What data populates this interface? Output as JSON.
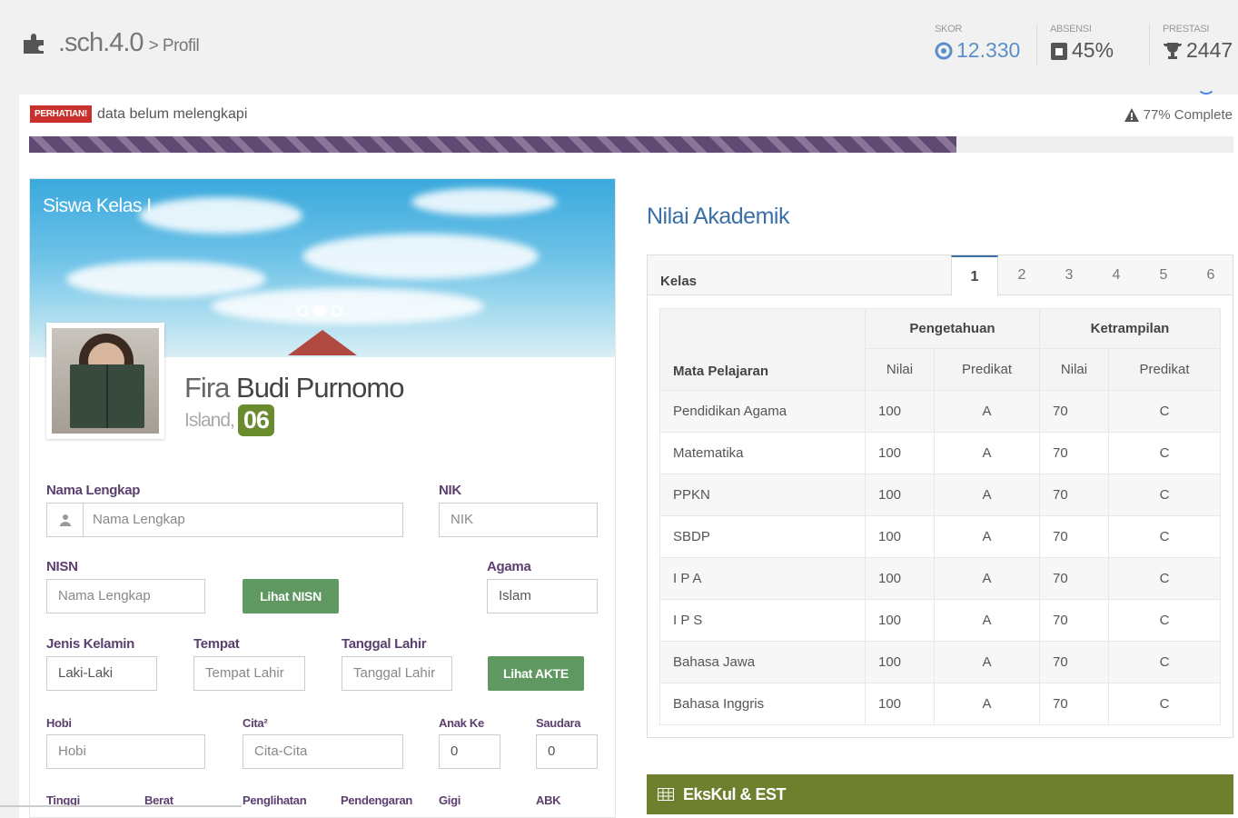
{
  "header": {
    "app_name": ".sch.4.0",
    "breadcrumb": "> Profil",
    "stats": [
      {
        "label": "SKOR",
        "value": "12.330",
        "icon": "coin-icon"
      },
      {
        "label": "ABSENSI",
        "value": "45%",
        "icon": "calendar-icon"
      },
      {
        "label": "PRESTASI",
        "value": "2447",
        "icon": "trophy-icon"
      }
    ]
  },
  "notice": {
    "badge": "PERHATIAN!",
    "message": "data belum melengkapi",
    "complete_text": "77% Complete",
    "progress_percent": 77
  },
  "profile": {
    "banner_title": "Siswa Kelas I",
    "first_name": "Fira",
    "last_name": "Budi Purnomo",
    "city": "Island,",
    "number": "06"
  },
  "form": {
    "nama_lengkap": {
      "label": "Nama Lengkap",
      "placeholder": "Nama Lengkap"
    },
    "nik": {
      "label": "NIK",
      "placeholder": "NIK"
    },
    "nisn": {
      "label": "NISN",
      "placeholder": "Nama Lengkap"
    },
    "lihat_nisn": "Lihat NISN",
    "agama": {
      "label": "Agama",
      "value": "Islam"
    },
    "jenis_kelamin": {
      "label": "Jenis Kelamin",
      "value": "Laki-Laki"
    },
    "tempat": {
      "label": "Tempat",
      "placeholder": "Tempat Lahir"
    },
    "tanggal_lahir": {
      "label": "Tanggal Lahir",
      "placeholder": "Tanggal Lahir"
    },
    "lihat_akte": "Lihat AKTE",
    "hobi": {
      "label": "Hobi",
      "placeholder": "Hobi"
    },
    "cita": {
      "label": "Cita²",
      "placeholder": "Cita-Cita"
    },
    "anak_ke": {
      "label": "Anak Ke",
      "value": "0"
    },
    "saudara": {
      "label": "Saudara",
      "value": "0"
    },
    "bottom_labels": [
      "Tinggi",
      "Berat",
      "Penglihatan",
      "Pendengaran",
      "Gigi",
      "ABK"
    ]
  },
  "nilai": {
    "title": "Nilai Akademik",
    "kelas_label": "Kelas",
    "tabs": [
      "1",
      "2",
      "3",
      "4",
      "5",
      "6"
    ],
    "active_tab": "1",
    "headers": {
      "mata_pelajaran": "Mata Pelajaran",
      "pengetahuan": "Pengetahuan",
      "ketrampilan": "Ketrampilan",
      "nilai": "Nilai",
      "predikat": "Predikat"
    },
    "rows": [
      {
        "subject": "Pendidikan Agama",
        "p_nilai": "100",
        "p_pred": "A",
        "k_nilai": "70",
        "k_pred": "C"
      },
      {
        "subject": "Matematika",
        "p_nilai": "100",
        "p_pred": "A",
        "k_nilai": "70",
        "k_pred": "C"
      },
      {
        "subject": "PPKN",
        "p_nilai": "100",
        "p_pred": "A",
        "k_nilai": "70",
        "k_pred": "C"
      },
      {
        "subject": "SBDP",
        "p_nilai": "100",
        "p_pred": "A",
        "k_nilai": "70",
        "k_pred": "C"
      },
      {
        "subject": "I P A",
        "p_nilai": "100",
        "p_pred": "A",
        "k_nilai": "70",
        "k_pred": "C"
      },
      {
        "subject": "I P S",
        "p_nilai": "100",
        "p_pred": "A",
        "k_nilai": "70",
        "k_pred": "C"
      },
      {
        "subject": "Bahasa Jawa",
        "p_nilai": "100",
        "p_pred": "A",
        "k_nilai": "70",
        "k_pred": "C"
      },
      {
        "subject": "Bahasa Inggris",
        "p_nilai": "100",
        "p_pred": "A",
        "k_nilai": "70",
        "k_pred": "C"
      }
    ]
  },
  "ekskul": {
    "title": "EksKul & EST"
  },
  "colors": {
    "accent_blue": "#3a6fa8",
    "label_purple": "#5b3f6e",
    "button_green": "#5f9860",
    "badge_red": "#c9302c",
    "ekskul_olive": "#6e7f2e"
  }
}
